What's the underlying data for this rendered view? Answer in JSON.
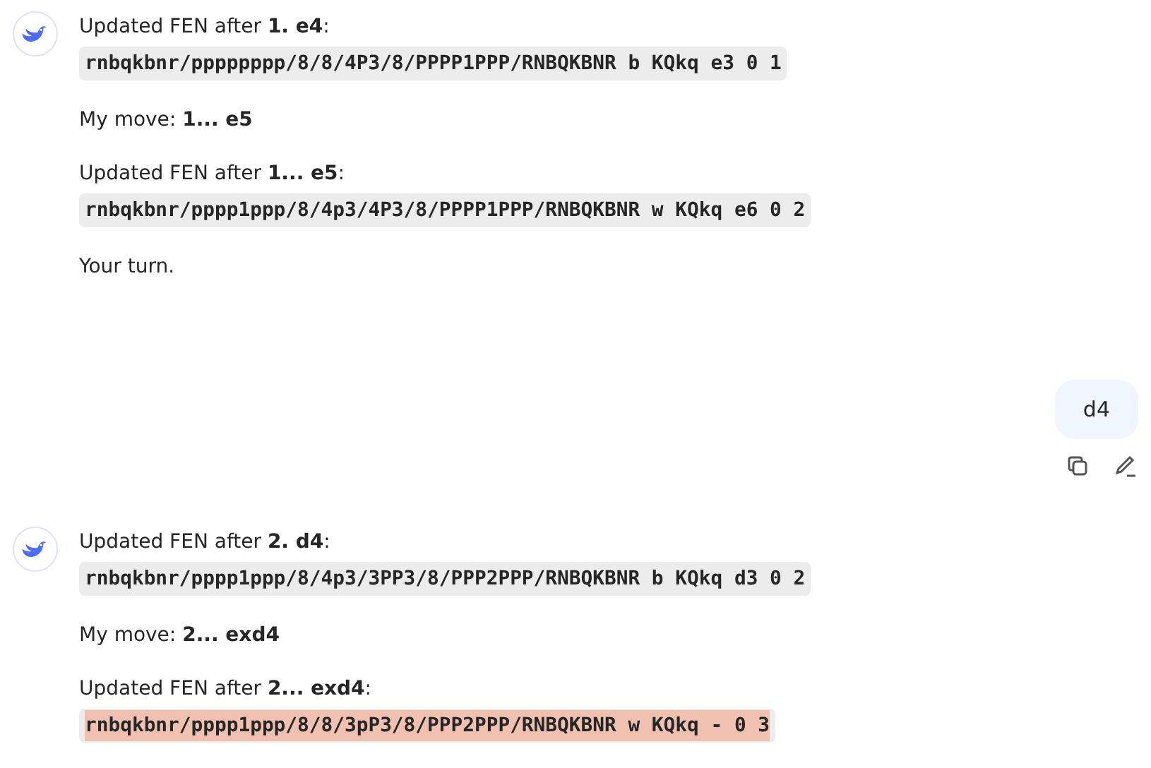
{
  "messages": [
    {
      "kind": "assistant",
      "blocks": [
        {
          "kind": "text",
          "text": "Updated FEN after **1. e4**:"
        },
        {
          "kind": "code",
          "text": "rnbqkbnr/pppppppp/8/8/4P3/8/PPPP1PPP/RNBQKBNR b KQkq e3 0 1",
          "highlighted": false
        },
        {
          "kind": "text",
          "text": "My move: **1... e5**"
        },
        {
          "kind": "text",
          "text": "Updated FEN after **1... e5**:"
        },
        {
          "kind": "code",
          "text": "rnbqkbnr/pppp1ppp/8/4p3/4P3/8/PPPP1PPP/RNBQKBNR w KQkq e6 0 2",
          "highlighted": false
        },
        {
          "kind": "text",
          "text": "Your turn."
        }
      ]
    },
    {
      "kind": "user",
      "text": "d4"
    },
    {
      "kind": "assistant",
      "blocks": [
        {
          "kind": "text",
          "text": "Updated FEN after **2. d4**:"
        },
        {
          "kind": "code",
          "text": "rnbqkbnr/pppp1ppp/8/4p3/3PP3/8/PPP2PPP/RNBQKBNR b KQkq d3 0 2",
          "highlighted": false
        },
        {
          "kind": "text",
          "text": "My move: **2... exd4**"
        },
        {
          "kind": "text",
          "text": "Updated FEN after **2... exd4**:"
        },
        {
          "kind": "code",
          "text": "rnbqkbnr/pppp1ppp/8/8/3pP3/8/PPP2PPP/RNBQKBNR w KQkq - 0 3",
          "highlighted": true
        }
      ]
    }
  ]
}
